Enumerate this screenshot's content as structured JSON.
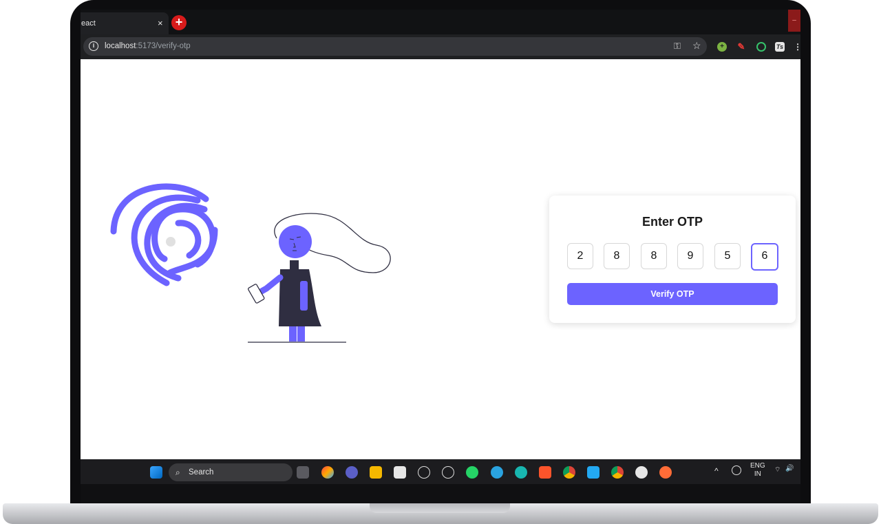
{
  "browser": {
    "tab_title": "eact",
    "tab_close": "×",
    "new_tab": "+",
    "window_btn": "–",
    "url_host": "localhost",
    "url_path": ":5173/verify-otp",
    "info_icon": "i",
    "key_icon": "⚿",
    "star_icon": "☆",
    "extensions": [
      "plus-green-icon",
      "pen-red-icon",
      "target-green-icon",
      "ts-icon",
      "menu-icon"
    ],
    "ext_ts_label": "Ts"
  },
  "otp": {
    "title": "Enter OTP",
    "digits": [
      "2",
      "8",
      "8",
      "9",
      "5",
      "6"
    ],
    "verify_label": "Verify OTP"
  },
  "taskbar": {
    "search_label": "Search",
    "search_glyph": "⌕",
    "lang": "ENG",
    "region": "IN",
    "caret": "^",
    "wifi_glyph": "⌔",
    "volume_glyph": "🔊"
  },
  "colors": {
    "accent": "#6c63ff",
    "illustration_dark": "#2f2e41",
    "fingerprint_dot": "#e0e0e0"
  }
}
